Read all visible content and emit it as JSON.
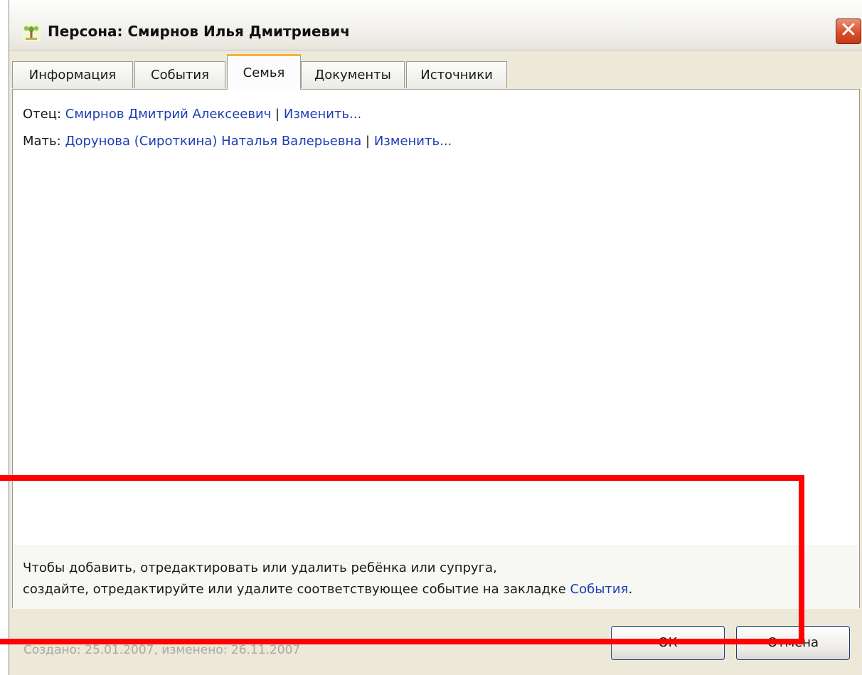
{
  "window": {
    "title": "Персона: Смирнов Илья Дмитриевич",
    "icon": "family-tree-icon",
    "close_icon": "close-icon"
  },
  "tabs": [
    {
      "label": "Информация",
      "active": false
    },
    {
      "label": "События",
      "active": false
    },
    {
      "label": "Семья",
      "active": true
    },
    {
      "label": "Документы",
      "active": false
    },
    {
      "label": "Источники",
      "active": false
    }
  ],
  "family": {
    "father": {
      "label": "Отец:",
      "name": "Смирнов Дмитрий Алексеевич",
      "separator": "|",
      "edit": "Изменить..."
    },
    "mother": {
      "label": "Мать:",
      "name": "Дорунова (Сироткина) Наталья Валерьевна",
      "separator": "|",
      "edit": "Изменить..."
    }
  },
  "hint": {
    "line1": "Чтобы добавить, отредактировать или удалить ребёнка или супруга,",
    "line2_prefix": "создайте, отредактируйте или удалите соответствующее событие на закладке",
    "line2_link": "События",
    "line2_suffix": "."
  },
  "footer": {
    "status": "Создано: 25.01.2007, изменено: 26.11.2007",
    "ok_label": "ОК",
    "cancel_label": "Отмена"
  },
  "colors": {
    "link": "#1f3eb4",
    "highlight_frame": "#ff0000",
    "active_tab_accent": "#f4b33d",
    "close_button": "#d9502b"
  }
}
